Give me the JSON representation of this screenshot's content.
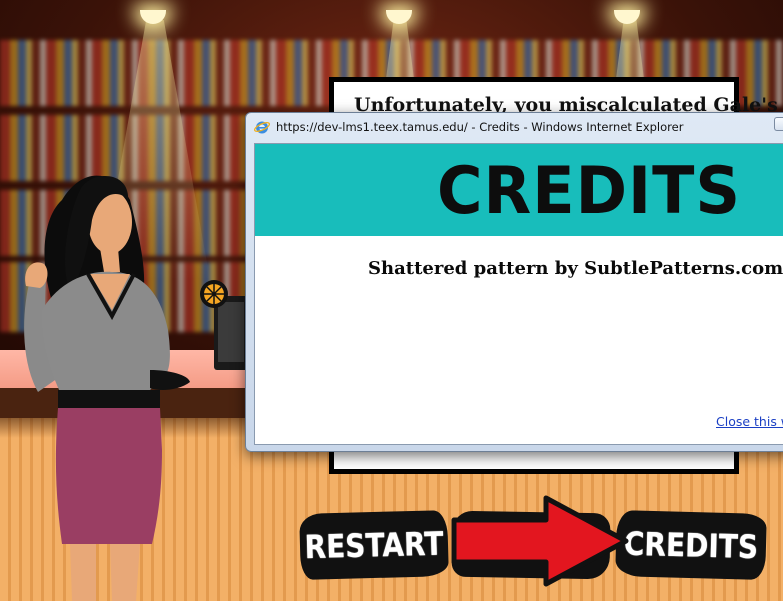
{
  "feedback": {
    "text": "Unfortunately, you miscalculated Gale's"
  },
  "popup": {
    "title": "https://dev-lms1.teex.tamus.edu/ - Credits - Windows Internet Explorer",
    "icon": "internet-explorer-icon",
    "heading": "CREDITS",
    "credit_line": "Shattered pattern by SubtlePatterns.com",
    "close_link": "Close this w",
    "banner_color": "#18bdbb",
    "link_color": "#1a3fc4"
  },
  "buttons": {
    "restart": "RESTART",
    "credits": "CREDITS"
  },
  "colors": {
    "arrow": "#e3161f",
    "button_bg": "#111111",
    "counter": "#f49a84"
  }
}
